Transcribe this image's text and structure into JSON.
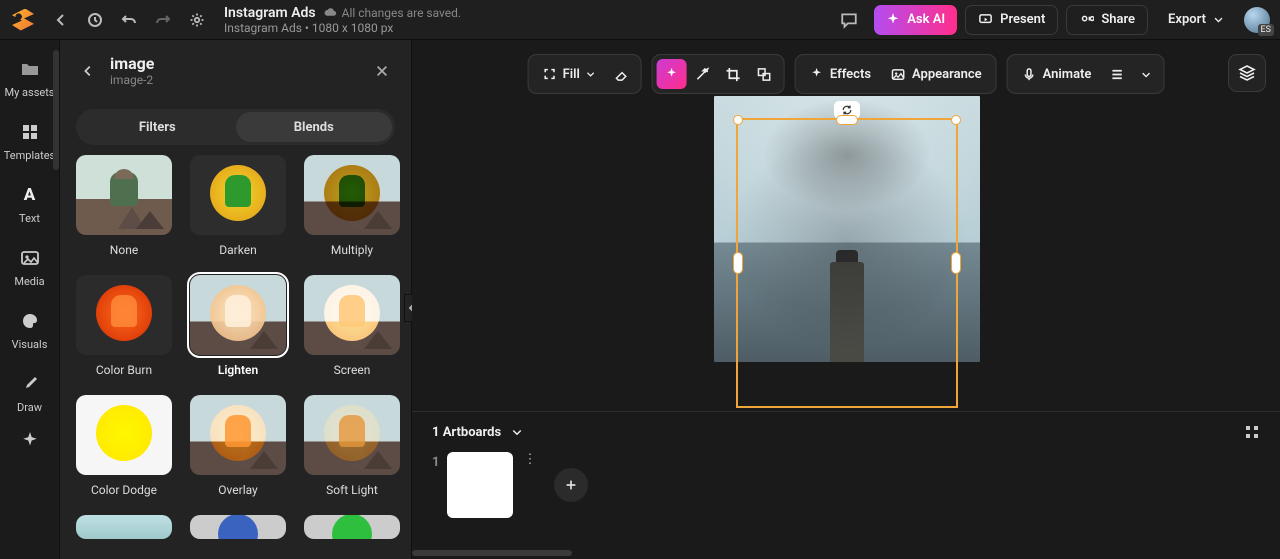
{
  "header": {
    "doc_title": "Instagram Ads",
    "saved_status": "All changes are saved.",
    "dimensions_line": "Instagram Ads • 1080 x 1080 px",
    "ask_ai": "Ask AI",
    "present": "Present",
    "share": "Share",
    "export": "Export",
    "avatar_badge": "ES"
  },
  "rail": {
    "items": [
      {
        "label": "My assets"
      },
      {
        "label": "Templates"
      },
      {
        "label": "Text"
      },
      {
        "label": "Media"
      },
      {
        "label": "Visuals"
      },
      {
        "label": "Draw"
      }
    ]
  },
  "panel": {
    "title": "image",
    "subtitle": "image-2",
    "tabs": {
      "filters": "Filters",
      "blends": "Blends",
      "active": "Blends"
    },
    "blends": [
      {
        "name": "None"
      },
      {
        "name": "Darken"
      },
      {
        "name": "Multiply"
      },
      {
        "name": "Color Burn"
      },
      {
        "name": "Lighten"
      },
      {
        "name": "Screen"
      },
      {
        "name": "Color Dodge"
      },
      {
        "name": "Overlay"
      },
      {
        "name": "Soft Light"
      }
    ],
    "selected_blend": "Lighten"
  },
  "context_bar": {
    "fill": "Fill",
    "effects": "Effects",
    "appearance": "Appearance",
    "animate": "Animate"
  },
  "artboards": {
    "heading": "1 Artboards",
    "items": [
      {
        "index": "1"
      }
    ]
  }
}
